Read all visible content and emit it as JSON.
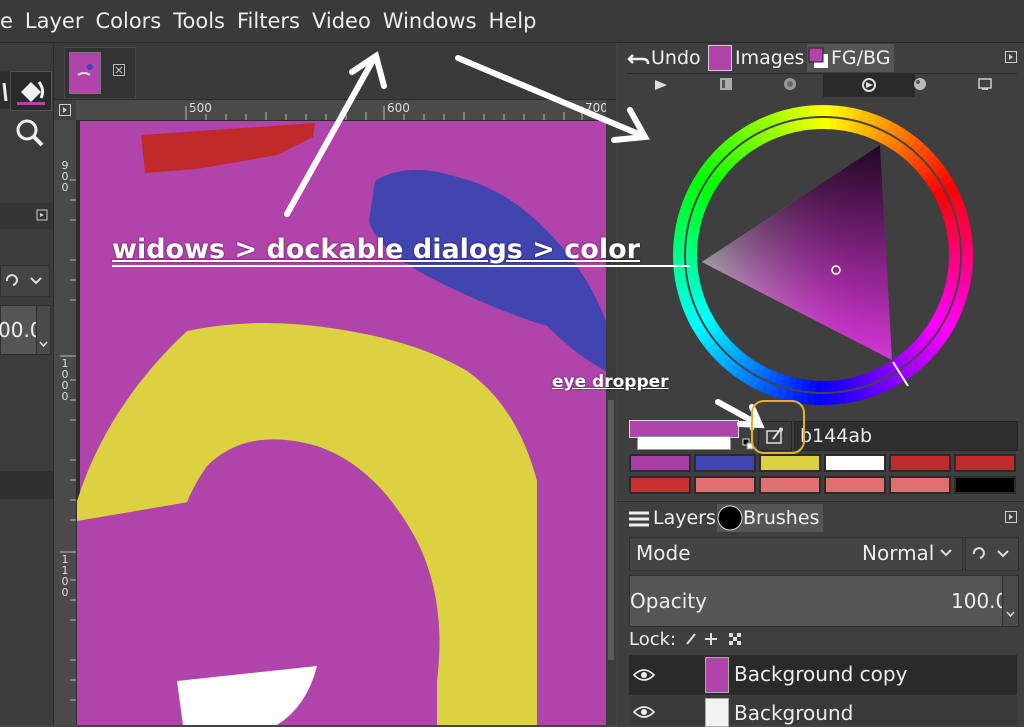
{
  "menubar": {
    "items": [
      "e",
      "Layer",
      "Colors",
      "Tools",
      "Filters",
      "Video",
      "Windows",
      "Help"
    ]
  },
  "toolbox": {
    "partial_value": "00.0"
  },
  "rulers": {
    "top": [
      "500",
      "600",
      "700"
    ],
    "left": [
      [
        "9",
        "0",
        "0"
      ],
      [
        "1",
        "0",
        "0",
        "0"
      ],
      [
        "1",
        "1",
        "0",
        "0"
      ]
    ]
  },
  "dock_top": {
    "tabs": [
      {
        "label": "Undo",
        "icon": "undo-icon"
      },
      {
        "label": "Images",
        "icon": "images-thumbnail-icon"
      },
      {
        "label": "FG/BG",
        "icon": "fg-bg-icon"
      }
    ],
    "selector_icons": [
      "dock-menu-icon",
      "scales-icon",
      "wheel-icon",
      "triangle-wheel-icon",
      "watercolor-icon",
      "cmyk-icon"
    ]
  },
  "colors": {
    "foreground": "#b144ab",
    "background": "#ffffff",
    "hex_value": "b144ab",
    "history": [
      "#a83fa3",
      "#4244b0",
      "#dcd140",
      "#ffffff",
      "#c12a2a",
      "#c12a2a",
      "#c83030",
      "#c83030",
      "#e07070",
      "#e07070",
      "#e07070",
      "#e07070",
      "#e07070",
      "#000000"
    ]
  },
  "layers_dock": {
    "tabs": [
      {
        "label": "Layers",
        "icon": "layers-icon"
      },
      {
        "label": "Brushes",
        "icon": "brush-icon"
      }
    ],
    "mode_label": "Mode",
    "mode_value": "Normal",
    "opacity_label": "Opacity",
    "opacity_value": "100.0",
    "lock_label": "Lock:",
    "layers": [
      {
        "name": "Background copy",
        "visible": true
      },
      {
        "name": "Background",
        "visible": true
      }
    ]
  },
  "annotations": {
    "main": "widows > dockable dialogs > color",
    "eyedropper": "eye dropper"
  }
}
